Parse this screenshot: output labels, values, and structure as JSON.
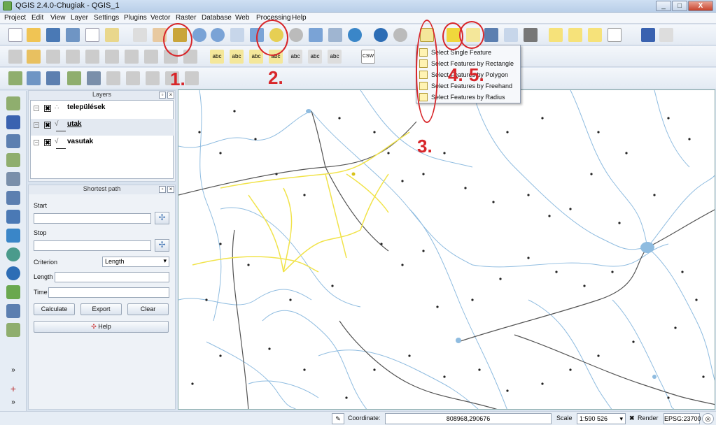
{
  "window": {
    "title": "QGIS 2.4.0-Chugiak - QGIS_1",
    "minimize": "_",
    "maximize": "□",
    "close": "X"
  },
  "menu": [
    "Project",
    "Edit",
    "View",
    "Layer",
    "Settings",
    "Plugins",
    "Vector",
    "Raster",
    "Database",
    "Web",
    "Processing",
    "Help"
  ],
  "layers_panel": {
    "title": "Layers",
    "layers": [
      {
        "name": "települések",
        "checked": "✖"
      },
      {
        "name": "utak",
        "checked": "✖"
      },
      {
        "name": "vasutak",
        "checked": "✖"
      }
    ]
  },
  "shortest_path": {
    "title": "Shortest path",
    "start_label": "Start",
    "stop_label": "Stop",
    "criterion_label": "Criterion",
    "criterion_value": "Length",
    "length_label": "Length",
    "time_label": "Time",
    "calculate": "Calculate",
    "export": "Export",
    "clear": "Clear",
    "help": "Help"
  },
  "select_menu": [
    "Select Single Feature",
    "Select Features by Rectangle",
    "Select Features by Polygon",
    "Select Features by Freehand",
    "Select Features by Radius"
  ],
  "toolbar_text": {
    "csw": "CSW",
    "abc": "abc"
  },
  "annotations": [
    "1.",
    "2.",
    "3.",
    "4.",
    "5."
  ],
  "status": {
    "coordinate_label": "Coordinate:",
    "coordinate_value": "808968,290676",
    "scale_label": "Scale",
    "scale_value": "1:590 526",
    "render_label": "Render",
    "render_checked": "✖",
    "crs": "EPSG:23700"
  },
  "colors": {
    "annotation": "#d8262a",
    "roads": "#f1e34a",
    "rivers": "#8fbce0",
    "rails": "#555555",
    "points": "#222222"
  }
}
